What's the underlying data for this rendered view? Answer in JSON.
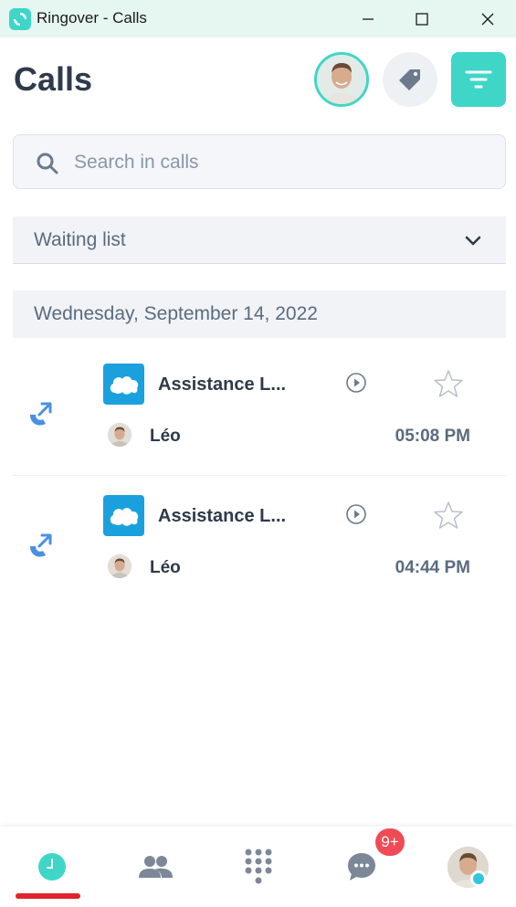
{
  "window": {
    "title": "Ringover - Calls",
    "minimize_label": "Minimize",
    "maximize_label": "Maximize",
    "close_label": "Close"
  },
  "header": {
    "title": "Calls",
    "accent_color": "#3fd6c8"
  },
  "search": {
    "placeholder": "Search in calls",
    "value": ""
  },
  "waiting_list": {
    "label": "Waiting list"
  },
  "date_group": {
    "label": "Wednesday, September 14, 2022"
  },
  "calls": [
    {
      "direction_icon": "outgoing-call-icon",
      "crm_icon": "salesforce-icon",
      "contact": "Assistance L...",
      "user": "Léo",
      "time": "05:08 PM",
      "starred": false
    },
    {
      "direction_icon": "outgoing-call-icon",
      "crm_icon": "salesforce-icon",
      "contact": "Assistance L...",
      "user": "Léo",
      "time": "04:44 PM",
      "starred": false
    }
  ],
  "bottom_nav": {
    "active_tab": "calls",
    "messages_badge": "9+",
    "items": [
      {
        "id": "calls",
        "icon": "clock-icon"
      },
      {
        "id": "contacts",
        "icon": "contacts-icon"
      },
      {
        "id": "dialpad",
        "icon": "dialpad-icon"
      },
      {
        "id": "messages",
        "icon": "chat-icon"
      },
      {
        "id": "profile",
        "icon": "avatar"
      }
    ],
    "active_color": "#e0232f"
  }
}
